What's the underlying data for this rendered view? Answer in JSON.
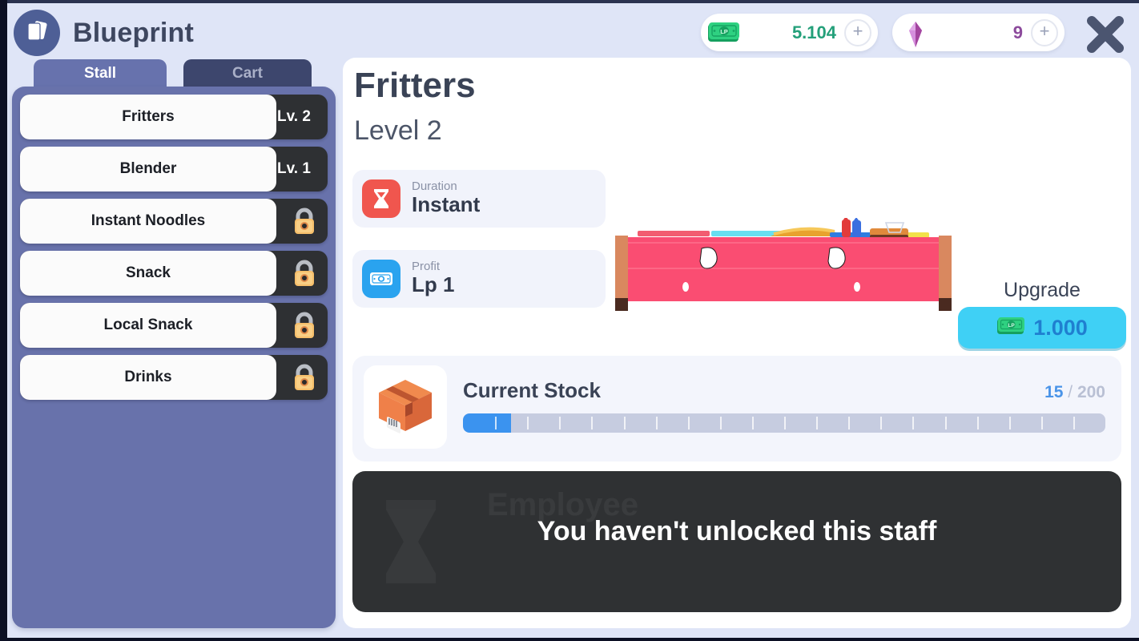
{
  "header": {
    "title": "Blueprint",
    "logo_icon": "blueprint-cards-icon",
    "close_icon": "close-icon",
    "money": {
      "icon": "banknote-icon",
      "value": "5.104",
      "add_label": "+"
    },
    "gem": {
      "icon": "gem-icon",
      "value": "9",
      "add_label": "+"
    }
  },
  "sidebar": {
    "tabs": [
      {
        "label": "Stall",
        "active": true
      },
      {
        "label": "Cart",
        "active": false
      }
    ],
    "items": [
      {
        "label": "Fritters",
        "badge": "Lv. 2",
        "locked": false
      },
      {
        "label": "Blender",
        "badge": "Lv. 1",
        "locked": false
      },
      {
        "label": "Instant Noodles",
        "badge": "",
        "locked": true
      },
      {
        "label": "Snack",
        "badge": "",
        "locked": true
      },
      {
        "label": "Local Snack",
        "badge": "",
        "locked": true
      },
      {
        "label": "Drinks",
        "badge": "",
        "locked": true
      }
    ]
  },
  "detail": {
    "title": "Fritters",
    "level": "Level 2",
    "stats": [
      {
        "label": "Duration",
        "value": "Instant",
        "icon": "hourglass-icon",
        "color": "#f0564e"
      },
      {
        "label": "Profit",
        "value": "Lp 1",
        "icon": "banknote-icon",
        "color": "#2aa3ef"
      }
    ],
    "artwork": "pink-food-stall-illustration",
    "upgrade": {
      "label": "Upgrade",
      "cost": "1.000",
      "icon": "banknote-icon"
    },
    "stock": {
      "icon": "package-box-icon",
      "title": "Current Stock",
      "current": "15",
      "separator": "/",
      "max": "200",
      "percent": 7.5,
      "segments": 20
    },
    "staff": {
      "message": "You haven't unlocked this staff",
      "ghost_label": "Employee",
      "ghost_icon": "hourglass-icon"
    }
  },
  "colors": {
    "background": "#dfe5f7",
    "sidebar_panel": "#6872ab",
    "tab_active": "#6772ad",
    "tab_inactive": "#3d466d",
    "accent_blue": "#3b93ef",
    "upgrade_button": "#3fd0f5",
    "money_green": "#24a07a",
    "gem_purple": "#8c4a9c",
    "staff_overlay": "#2f3133"
  }
}
